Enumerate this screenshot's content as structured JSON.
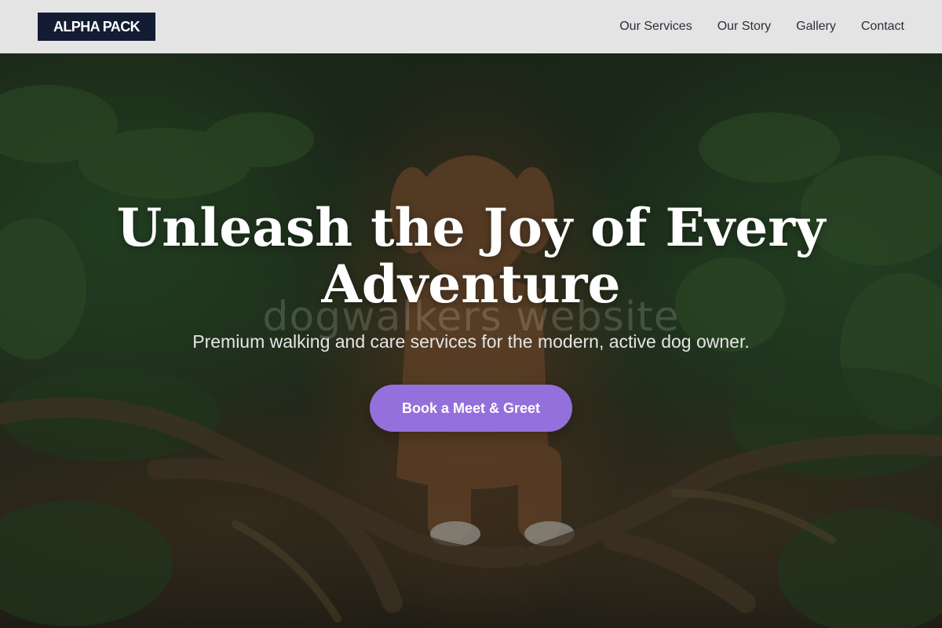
{
  "brand": {
    "logo_text": "ALPHA PACK"
  },
  "nav": {
    "items": [
      {
        "label": "Our Services"
      },
      {
        "label": "Our Story"
      },
      {
        "label": "Gallery"
      },
      {
        "label": "Contact"
      }
    ]
  },
  "hero": {
    "title": "Unleash the Joy of Every Adventure",
    "subtitle": "Premium walking and care services for the modern, active dog owner.",
    "watermark": "dogwalkers website",
    "cta_label": "Book a Meet & Greet",
    "background_image": "dog-in-forest-photo"
  },
  "colors": {
    "header_bg": "#ececec",
    "logo_bg": "#131c33",
    "nav_text": "#2a2f3a",
    "cta_bg": "#9470dc",
    "hero_text": "#ffffff"
  }
}
